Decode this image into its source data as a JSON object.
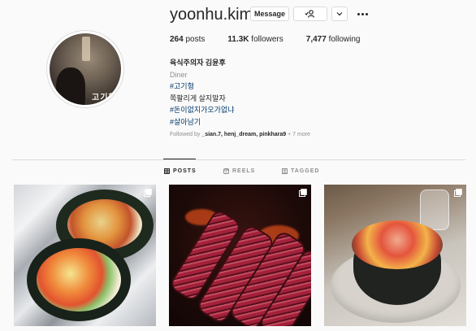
{
  "profile": {
    "username": "yoonhu.kim",
    "avatar_sign": "고기형",
    "buttons": {
      "message": "Message",
      "follow_icon": "person-check-icon",
      "dropdown_icon": "chevron-down-icon",
      "more_icon": "more-horizontal-icon"
    },
    "stats": {
      "posts_count": "264",
      "posts_label": "posts",
      "followers_count": "11.3K",
      "followers_label": "followers",
      "following_count": "7,477",
      "following_label": "following"
    },
    "bio": {
      "name": "육식주의자 김윤후",
      "category": "Diner",
      "line1": "#고기형",
      "line2": "쪽팔리게 살지말자",
      "line3": "#돈이없지가오가없냐",
      "line4": "#살아남기",
      "followed_prefix": "Followed by ",
      "followed_names": "_sian.7, henj_dream, pinkhara9",
      "followed_suffix": " + 7 more"
    }
  },
  "tabs": [
    {
      "label": "POSTS",
      "icon": "grid-icon",
      "active": true
    },
    {
      "label": "REELS",
      "icon": "reels-icon",
      "active": false
    },
    {
      "label": "TAGGED",
      "icon": "tagged-icon",
      "active": false
    }
  ],
  "posts": [
    {
      "subject": "kimbap on foil",
      "multi_icon": "carousel-icon"
    },
    {
      "subject": "grilled beef",
      "multi_icon": "carousel-icon"
    },
    {
      "subject": "sushi tower",
      "multi_icon": "carousel-icon"
    }
  ],
  "colors": {
    "link": "#00376b",
    "muted": "#8e8e8e",
    "text": "#262626",
    "border": "#dbdbdb",
    "background": "#fafafa"
  }
}
